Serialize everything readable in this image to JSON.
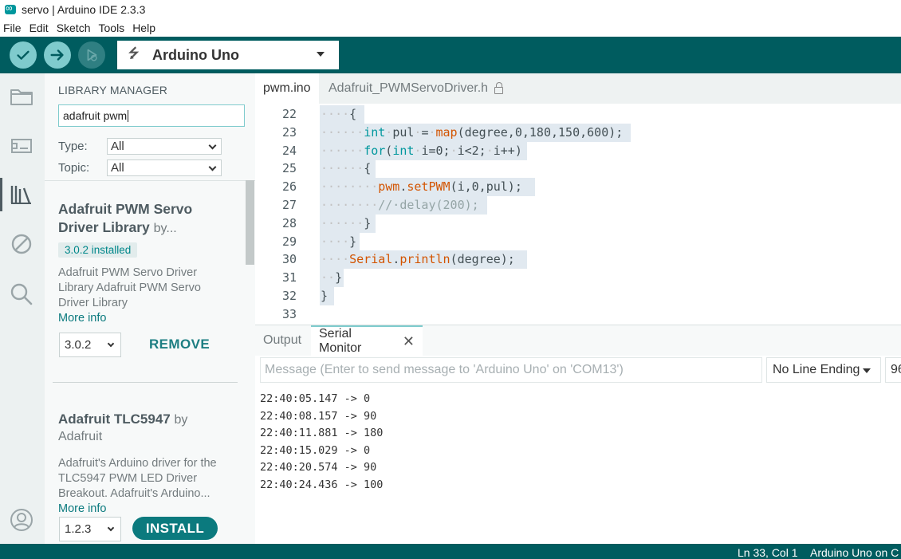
{
  "window": {
    "title": "servo | Arduino IDE 2.3.3"
  },
  "menubar": {
    "items": [
      "File",
      "Edit",
      "Sketch",
      "Tools",
      "Help"
    ]
  },
  "toolbar": {
    "board": "Arduino Uno"
  },
  "library_manager": {
    "title": "LIBRARY MANAGER",
    "search_value": "adafruit pwm",
    "filters": {
      "type_label": "Type:",
      "type_value": "All",
      "topic_label": "Topic:",
      "topic_value": "All"
    },
    "libraries": [
      {
        "name": "Adafruit PWM Servo Driver Library",
        "name_line1": "Adafruit PWM Servo",
        "name_line2": "Driver Library",
        "by": "by...",
        "installed_badge": "3.0.2 installed",
        "description_lines": [
          "Adafruit PWM Servo Driver",
          "Library Adafruit PWM Servo",
          "Driver Library"
        ],
        "more_info": "More info",
        "version": "3.0.2",
        "action": "REMOVE"
      },
      {
        "name": "Adafruit TLC5947",
        "by": "by",
        "author": "Adafruit",
        "description_lines": [
          "Adafruit's Arduino driver for the",
          "TLC5947 PWM LED Driver",
          "Breakout. Adafruit's Arduino..."
        ],
        "more_info": "More info",
        "version": "1.2.3",
        "action": "INSTALL"
      }
    ]
  },
  "editor": {
    "tabs": [
      {
        "label": "pwm.ino",
        "active": true
      },
      {
        "label": "Adafruit_PWMServoDriver.h",
        "active": false,
        "locked": true
      }
    ],
    "line_numbers": [
      "22",
      "23",
      "24",
      "25",
      "26",
      "27",
      "28",
      "29",
      "30",
      "31",
      "32",
      "33"
    ],
    "lines": [
      "····{",
      "······int·pul·=·map(degree,0,180,150,600);",
      "······for(int·i=0;·i<2;·i++)",
      "······{",
      "········pwm.setPWM(i,0,pul);",
      "········//·delay(200);",
      "······}",
      "····}",
      "····Serial.println(degree);",
      "··}",
      "}",
      ""
    ]
  },
  "bottom_panel": {
    "tabs": [
      {
        "label": "Output",
        "active": false
      },
      {
        "label": "Serial Monitor",
        "active": true
      }
    ],
    "message_placeholder": "Message (Enter to send message to 'Arduino Uno' on 'COM13')",
    "line_ending": "No Line Ending",
    "baud_partial": "96",
    "serial_output": [
      "22:40:05.147 -> 0",
      "22:40:08.157 -> 90",
      "22:40:11.881 -> 180",
      "22:40:15.029 -> 0",
      "22:40:20.574 -> 90",
      "22:40:24.436 -> 100"
    ]
  },
  "statusbar": {
    "position": "Ln 33, Col 1",
    "board": "Arduino Uno on C"
  },
  "colors": {
    "teal_dark": "#005c5f",
    "teal_button": "#7fcbcd",
    "teal_text": "#00979d",
    "orange_fn": "#d35400"
  },
  "icons": {
    "verify": "check-icon",
    "upload": "arrow-right-icon",
    "debug": "debug-icon",
    "usb": "usb-icon",
    "sketchbook": "folder-icon",
    "boards": "board-icon",
    "library": "library-icon",
    "debugger": "no-entry-icon",
    "search": "search-icon",
    "profile": "profile-icon",
    "lock": "lock-icon",
    "close": "close-icon"
  }
}
